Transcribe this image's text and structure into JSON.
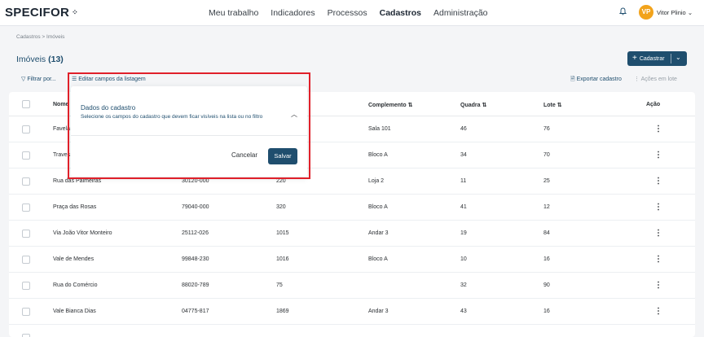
{
  "app": {
    "logo_text": "SPECIFOR",
    "logo_mark": "⁘",
    "nav": [
      "Meu trabalho",
      "Indicadores",
      "Processos",
      "Cadastros",
      "Administração"
    ],
    "nav_active": "Cadastros",
    "user_initials": "VP",
    "user_name": "Vitor Plinio",
    "user_menu_icon": "chevron-down-icon",
    "avatar_color": "#f2a31b",
    "brand_color": "#1f4e6e"
  },
  "breadcrumb": "Cadastros > Imóveis",
  "page": {
    "title": "Imóveis",
    "count": "(13)"
  },
  "toolbar": {
    "cadastrar_label": "Cadastrar",
    "filter_label": "Filtrar por...",
    "edit_fields_label": "Editar campos da listagem",
    "export_label": "Exportar cadastro",
    "bulk_label": "Ações em lote"
  },
  "table": {
    "columns": [
      "Nome",
      "",
      "",
      "Complemento",
      "Quadra",
      "Lote",
      "Ação"
    ],
    "rows": [
      {
        "nome": "Favela",
        "cep": "",
        "numero": "",
        "complemento": "Sala 101",
        "quadra": "46",
        "lote": "76"
      },
      {
        "nome": "Traves",
        "cep": "",
        "numero": "",
        "complemento": "Bloco A",
        "quadra": "34",
        "lote": "70"
      },
      {
        "nome": "Rua das Palmeiras",
        "cep": "30120-000",
        "numero": "220",
        "complemento": "Loja 2",
        "quadra": "11",
        "lote": "25"
      },
      {
        "nome": "Praça das Rosas",
        "cep": "79040-000",
        "numero": "320",
        "complemento": "Bloco A",
        "quadra": "41",
        "lote": "12"
      },
      {
        "nome": "Via João Vitor Monteiro",
        "cep": "25112-026",
        "numero": "1015",
        "complemento": "Andar 3",
        "quadra": "19",
        "lote": "84"
      },
      {
        "nome": "Vale de Mendes",
        "cep": "99848-230",
        "numero": "1016",
        "complemento": "Bloco A",
        "quadra": "10",
        "lote": "16"
      },
      {
        "nome": "Rua do Comércio",
        "cep": "88020-789",
        "numero": "75",
        "complemento": "",
        "quadra": "32",
        "lote": "90"
      },
      {
        "nome": "Vale Bianca Dias",
        "cep": "04775-817",
        "numero": "1869",
        "complemento": "Andar 3",
        "quadra": "43",
        "lote": "16"
      }
    ]
  },
  "modal": {
    "title": "Dados do cadastro",
    "subtitle": "Selecione os campos do cadastro que devem ficar visíveis na lista ou no filtro",
    "cancel_label": "Cancelar",
    "save_label": "Salvar"
  },
  "highlight_color": "#e0202a"
}
